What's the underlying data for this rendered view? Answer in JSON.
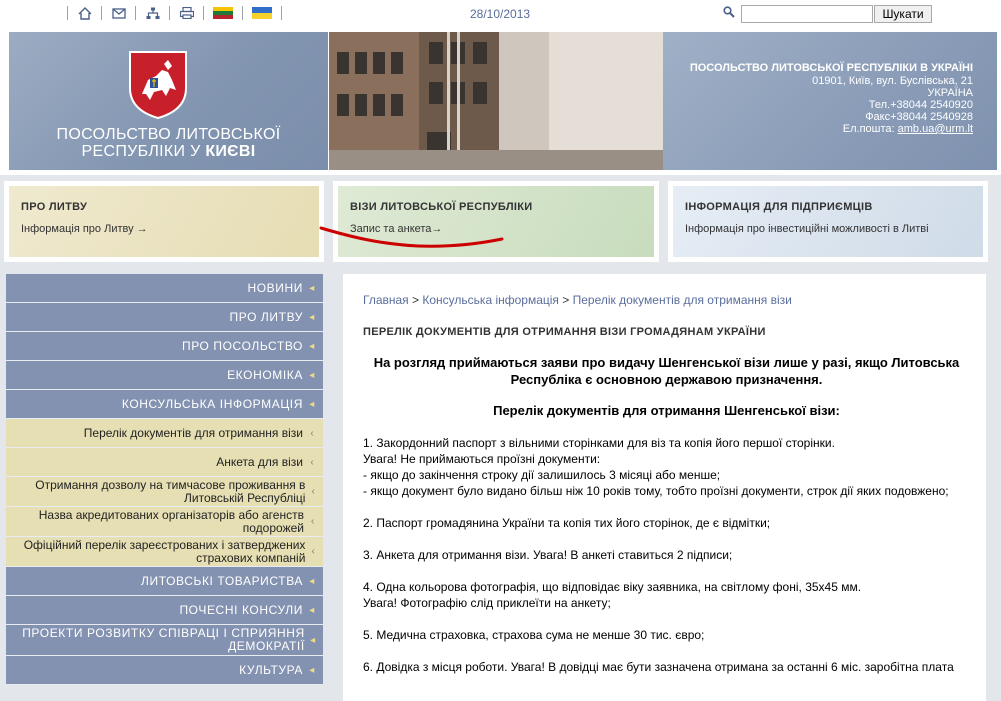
{
  "topbar": {
    "icons": [
      "home-icon",
      "mail-icon",
      "sitemap-icon",
      "print-icon",
      "flag-lithuania-icon",
      "flag-ukraine-icon"
    ],
    "date": "28/10/2013",
    "search": {
      "placeholder": "",
      "button_label": "Шукати"
    }
  },
  "header": {
    "embassy_name_line1": "ПОСОЛЬСТВО ЛИТОВСЬКОЇ",
    "embassy_name_line2": "РЕСПУБЛІКИ У",
    "embassy_name_city": "КИЄВІ",
    "contact": {
      "title": "ПОСОЛЬСТВО ЛИТОВСЬКОЇ РЕСПУБЛІКИ В УКРАЇНІ",
      "address": "01901, Київ, вул. Буслівська, 21",
      "country": "УКРАЇНА",
      "phone": "Тел.+38044 2540920",
      "fax": "Факс+38044 2540928",
      "email_label": "Ел.пошта:",
      "email": "amb.ua@urm.lt"
    }
  },
  "categories": [
    {
      "title": "ПРО ЛИТВУ",
      "link": "Інформація про Литву →"
    },
    {
      "title": "ВІЗИ ЛИТОВСЬКОЇ РЕСПУБЛІКИ",
      "link": "Запис та анкета→"
    },
    {
      "title": "ІНФОРМАЦІЯ ДЛЯ ПІДПРИЄМЦІВ",
      "link": "Інформація про інвестиційні можливості в Литві"
    }
  ],
  "sidebar": {
    "items": [
      {
        "label": "НОВИНИ",
        "type": "main"
      },
      {
        "label": "ПРО ЛИТВУ",
        "type": "main"
      },
      {
        "label": "ПРО ПОСОЛЬСТВО",
        "type": "main"
      },
      {
        "label": "ЕКОНОМІКА",
        "type": "main"
      },
      {
        "label": "КОНСУЛЬСЬКА ІНФОРМАЦІЯ",
        "type": "main"
      },
      {
        "label": "Перелік документів для отримання візи",
        "type": "sub"
      },
      {
        "label": "Анкета для візи",
        "type": "sub"
      },
      {
        "label": "Отримання дозволу на тимчасове проживання в Литовській Республіці",
        "type": "sub"
      },
      {
        "label": "Назва акредитованих організаторів або агенств подорожей",
        "type": "sub"
      },
      {
        "label": "Офіційний перелік зареєстрованих і затверджених страхових компаній",
        "type": "sub"
      },
      {
        "label": "ЛИТОВСЬКІ ТОВАРИСТВА",
        "type": "main"
      },
      {
        "label": "ПОЧЕСНІ КОНСУЛИ",
        "type": "main"
      },
      {
        "label": "ПРОЕКТИ РОЗВИТКУ СПІВРАЦІ І СПРИЯННЯ ДЕМОКРАТІЇ",
        "type": "main"
      },
      {
        "label": "КУЛЬТУРА",
        "type": "main"
      }
    ]
  },
  "content": {
    "breadcrumb": [
      "Главная",
      "Консульська інформація",
      "Перелік документів для отримання візи"
    ],
    "breadcrumb_sep": ">",
    "title": "ПЕРЕЛІК ДОКУМЕНТІВ ДЛЯ ОТРИМАННЯ ВІЗИ ГРОМАДЯНАМ УКРАЇНИ",
    "intro": "На розгляд приймаються заяви про видачу Шенгенської візи лише у разі, якщо Литовська Республіка є основною державою призначення.",
    "list_title": "Перелік документів для отримання Шенгенської візи:",
    "items": {
      "p1a": "1. Закордонний паспорт з вільними сторінками для віз та копія його першої сторінки.",
      "p1b": "Увага! Не приймаються проїзні документи:",
      "p1c": "- якщо до закінчення строку дії залишилось 3 місяці або менше;",
      "p1d": "- якщо документ було видано більш ніж 10 років тому, тобто проїзні документи, строк дії яких подовжено;",
      "p2": "2. Паспорт громадянина України та копія тих його сторінок, де є відмітки;",
      "p3": "3. Анкета для отримання візи. Увага! В анкеті ставиться 2 підписи;",
      "p4a": "4.  Одна кольорова фотографія, що відповідає віку заявника, на світлому фоні, 35х45 мм.",
      "p4b": "Увага! Фотографію слід приклеїти на анкету;",
      "p5": "5.  Медична страховка, страхова сума не менше 30 тис. євро;",
      "p6": "6. Довідка з місця роботи. Увага! В довідці має бути зазначена отримана за останні 6 міс. заробітна плата"
    }
  },
  "colors": {
    "sidebar_main": "#8492b1",
    "sidebar_sub": "#e6dfb3",
    "link": "#5a6e9c",
    "annotation": "#cc0000"
  }
}
